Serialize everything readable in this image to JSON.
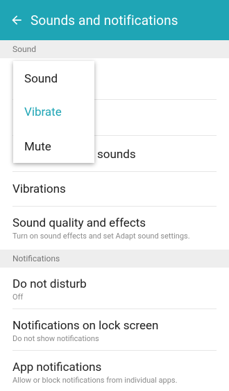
{
  "header": {
    "title": "Sounds and notifications",
    "back_icon": "arrow-left-icon"
  },
  "sections": {
    "sound": "Sound",
    "notifications": "Notifications"
  },
  "popup": {
    "options": [
      "Sound",
      "Vibrate",
      "Mute"
    ],
    "selected": "Vibrate"
  },
  "behind_popup": {
    "partial_label": "sounds"
  },
  "rows": {
    "vibrations": {
      "title": "Vibrations"
    },
    "sound_quality": {
      "title": "Sound quality and effects",
      "subtitle": "Turn on sound effects and set Adapt sound settings."
    },
    "do_not_disturb": {
      "title": "Do not disturb",
      "subtitle": "Off"
    },
    "lock_screen": {
      "title": "Notifications on lock screen",
      "subtitle": "Do not show notifications"
    },
    "app_notifications": {
      "title": "App notifications",
      "subtitle": "Allow or block notifications from individual apps."
    }
  },
  "colors": {
    "accent": "#1fa5b5",
    "header_text": "#ffffff"
  }
}
